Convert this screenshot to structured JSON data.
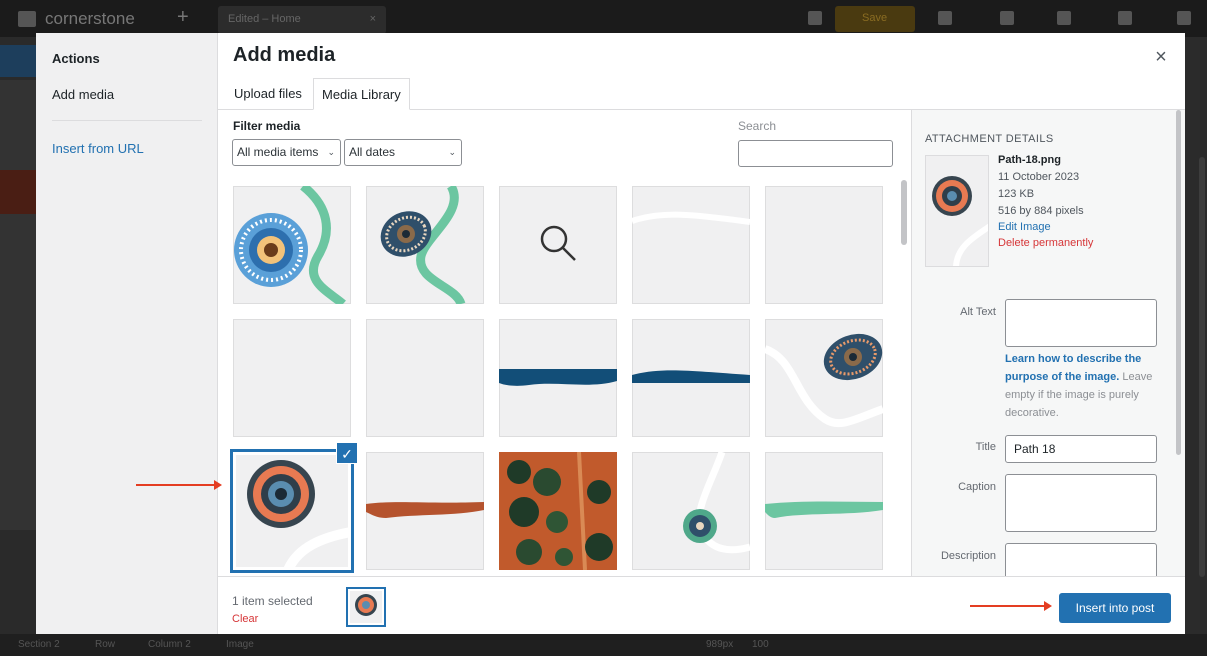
{
  "editor": {
    "brand": "cornerstone",
    "tab_title": "Edited – Home",
    "save_label": "Save",
    "status_items": [
      "Section 2",
      "Row",
      "Column 2",
      "Image"
    ],
    "viewport": "989px",
    "zoom": "100"
  },
  "modal": {
    "title": "Add media",
    "close": "×",
    "menu": {
      "actions": "Actions",
      "add_media": "Add media",
      "insert_from_url": "Insert from URL"
    },
    "tabs": [
      "Upload files",
      "Media Library"
    ],
    "active_tab": "Media Library"
  },
  "filters": {
    "label": "Filter media",
    "type_value": "All media items",
    "date_value": "All dates",
    "search_label": "Search",
    "search_value": ""
  },
  "grid": {
    "items": [
      {
        "type": "dot-path",
        "selected": false
      },
      {
        "type": "oval-path",
        "selected": false
      },
      {
        "type": "placeholder",
        "selected": false
      },
      {
        "type": "white-line",
        "selected": false
      },
      {
        "type": "blank",
        "selected": false
      },
      {
        "type": "blank",
        "selected": false
      },
      {
        "type": "blank",
        "selected": false
      },
      {
        "type": "blue-band",
        "selected": false
      },
      {
        "type": "blue-band-2",
        "selected": false
      },
      {
        "type": "oval-corner",
        "selected": false
      },
      {
        "type": "flower",
        "selected": true
      },
      {
        "type": "brown-band",
        "selected": false
      },
      {
        "type": "aerial",
        "selected": false
      },
      {
        "type": "green-dot",
        "selected": false
      },
      {
        "type": "green-band",
        "selected": false
      }
    ]
  },
  "details": {
    "heading": "ATTACHMENT DETAILS",
    "filename": "Path-18.png",
    "date": "11 October 2023",
    "size": "123 KB",
    "dimensions": "516 by 884 pixels",
    "edit_link": "Edit Image",
    "delete_link": "Delete permanently",
    "alt_label": "Alt Text",
    "alt_value": "",
    "help_link": "Learn how to describe the purpose of the image.",
    "help_rest": " Leave empty if the image is purely decorative.",
    "title_label": "Title",
    "title_value": "Path 18",
    "caption_label": "Caption",
    "caption_value": "",
    "description_label": "Description",
    "description_value": ""
  },
  "toolbar": {
    "selected_count": "1 item selected",
    "clear": "Clear",
    "insert_label": "Insert into post"
  },
  "colors": {
    "accent": "#2271b1",
    "danger": "#d63638",
    "arrow": "#e43d22"
  }
}
